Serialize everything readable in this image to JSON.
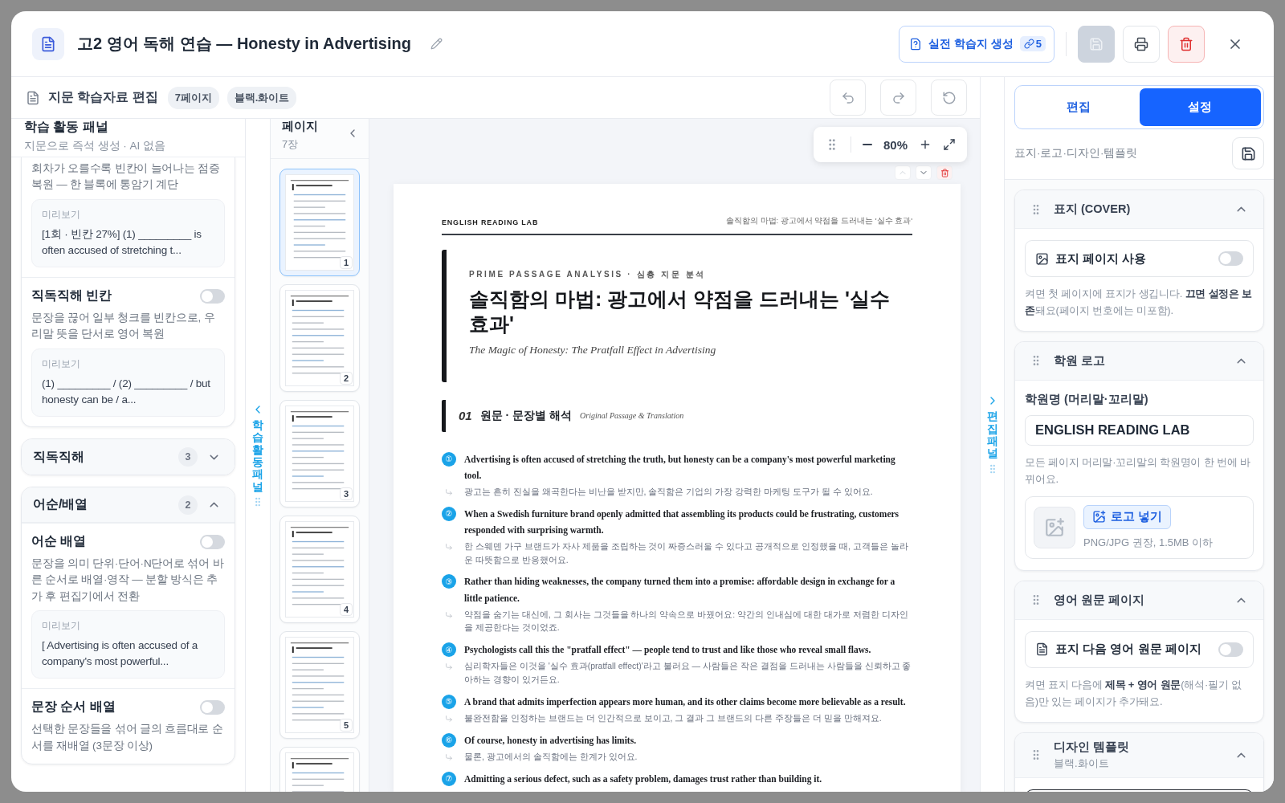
{
  "header": {
    "title": "고2 영어 독해 연습 — Honesty in Advertising",
    "generate_button": {
      "label": "실전 학습지 생성",
      "count": "5"
    }
  },
  "toolbar": {
    "title": "지문 학습자료 편집",
    "badges": [
      "7페이지",
      "블랙.화이트"
    ]
  },
  "activity_panel": {
    "title": "학습 활동 패널",
    "subtitle": "지문으로 즉석 생성 · AI 없음",
    "cards": [
      {
        "items": [
          {
            "description": "회차가 오를수록 빈칸이 늘어나는 점증 복원 — 한 블록에 통암기 계단",
            "preview_label": "미리보기",
            "preview": "[1회 · 빈칸 27%] (1) _________ is often accused of stretching t..."
          },
          {
            "title": "직독직해 빈칸",
            "on": false,
            "description": "문장을 끊어 일부 청크를 빈칸으로, 우리말 뜻을 단서로 영어 복원",
            "preview_label": "미리보기",
            "preview": "(1) _________ / (2) _________ / but honesty can be / a..."
          }
        ]
      },
      {
        "title": "직독직해",
        "count": "3",
        "expanded": false
      },
      {
        "title": "어순/배열",
        "count": "2",
        "expanded": true,
        "items": [
          {
            "title": "어순 배열",
            "on": false,
            "description": "문장을 의미 단위·단어·N단어로 섞어 바른 순서로 배열·영작 — 분할 방식은 추가 후 편집기에서 전환",
            "preview_label": "미리보기",
            "preview": "[ Advertising is often accused of a company's most powerful..."
          },
          {
            "title": "문장 순서 배열",
            "on": false,
            "description": "선택한 문장들을 섞어 글의 흐름대로 순서를 재배열 (3문장 이상)"
          }
        ]
      }
    ]
  },
  "left_rail": {
    "label": "학습 활동 패널"
  },
  "pages": {
    "title": "페이지",
    "count": "7장",
    "thumbnails": [
      {
        "number": "1",
        "selected": true
      },
      {
        "number": "2",
        "selected": false
      },
      {
        "number": "3",
        "selected": false
      },
      {
        "number": "4",
        "selected": false
      },
      {
        "number": "5",
        "selected": false
      },
      {
        "selected": false
      }
    ]
  },
  "zoom": {
    "value": "80%"
  },
  "document": {
    "running_left": "ENGLISH READING LAB",
    "running_right": "솔직함의 마법: 광고에서 약점을 드러내는 '실수 효과'",
    "eyebrow": "PRIME PASSAGE ANALYSIS · 심층 지문 분석",
    "title": "솔직함의 마법: 광고에서 약점을 드러내는 '실수 효과'",
    "subtitle": "The Magic of Honesty: The Pratfall Effect in Advertising",
    "section": {
      "number": "01",
      "title": "원문 · 문장별 해석",
      "subtitle": "Original Passage & Translation"
    },
    "sentences": [
      {
        "number": "①",
        "english": "Advertising is often accused of stretching the truth, but honesty can be a company's most powerful marketing tool.",
        "korean": "광고는 흔히 진실을 왜곡한다는 비난을 받지만, 솔직함은 기업의 가장 강력한 마케팅 도구가 될 수 있어요."
      },
      {
        "number": "②",
        "english": "When a Swedish furniture brand openly admitted that assembling its products could be frustrating, customers responded with surprising warmth.",
        "korean": "한 스웨덴 가구 브랜드가 자사 제품을 조립하는 것이 짜증스러울 수 있다고 공개적으로 인정했을 때, 고객들은 놀라운 따뜻함으로 반응했어요."
      },
      {
        "number": "③",
        "english": "Rather than hiding weaknesses, the company turned them into a promise: affordable design in exchange for a little patience.",
        "korean": "약점을 숨기는 대신에, 그 회사는 그것들을 하나의 약속으로 바꿨어요: 약간의 인내심에 대한 대가로 저렴한 디자인을 제공한다는 것이었죠."
      },
      {
        "number": "④",
        "english": "Psychologists call this the \"pratfall effect\" — people tend to trust and like those who reveal small flaws.",
        "korean": "심리학자들은 이것을 '실수 효과(pratfall effect)'라고 불러요 — 사람들은 작은 결점을 드러내는 사람들을 신뢰하고 좋아하는 경향이 있거든요."
      },
      {
        "number": "⑤",
        "english": "A brand that admits imperfection appears more human, and its other claims become more believable as a result.",
        "korean": "불완전함을 인정하는 브랜드는 더 인간적으로 보이고, 그 결과 그 브랜드의 다른 주장들은 더 믿을 만해져요."
      },
      {
        "number": "⑥",
        "english": "Of course, honesty in advertising has limits.",
        "korean": "물론, 광고에서의 솔직함에는 한계가 있어요."
      },
      {
        "number": "⑦",
        "english": "Admitting a serious defect, such as a safety problem, damages trust rather than building it."
      }
    ]
  },
  "right_rail": {
    "label": "편집 패널"
  },
  "settings": {
    "tabs": [
      {
        "label": "편집",
        "selected": false
      },
      {
        "label": "설정",
        "selected": true
      }
    ],
    "subtitle": "표지·로고·디자인·템플릿",
    "sections": [
      {
        "kind": "image-toggle",
        "title": "표지 (COVER)",
        "expanded": true,
        "toggle_label": "표지 페이지 사용",
        "on": false,
        "note": "켜면 첫 페이지에 표지가 생깁니다. **끄면 설정은 보존**돼요(페이지 번호에는 미포함)."
      },
      {
        "kind": "logo",
        "title": "학원 로고",
        "expanded": true,
        "field_label": "학원명 (머리말·꼬리말)",
        "field_value": "ENGLISH READING LAB",
        "note": "모든 페이지 머리말·꼬리말의 학원명이 한 번에 바뀌어요.",
        "logo_button": "로고 넣기",
        "logo_hint": "PNG/JPG 권장, 1.5MB 이하"
      },
      {
        "kind": "page-toggle",
        "title": "영어 원문 페이지",
        "expanded": true,
        "toggle_label": "표지 다음 영어 원문 페이지",
        "on": false,
        "note": "켜면 표지 다음에 **제목 + 영어 원문**(해석·필기 없음)만 있는 페이지가 추가돼요."
      },
      {
        "kind": "template",
        "title": "디자인 템플릿",
        "subtitle": "블랙.화이트",
        "expanded": true
      }
    ]
  }
}
